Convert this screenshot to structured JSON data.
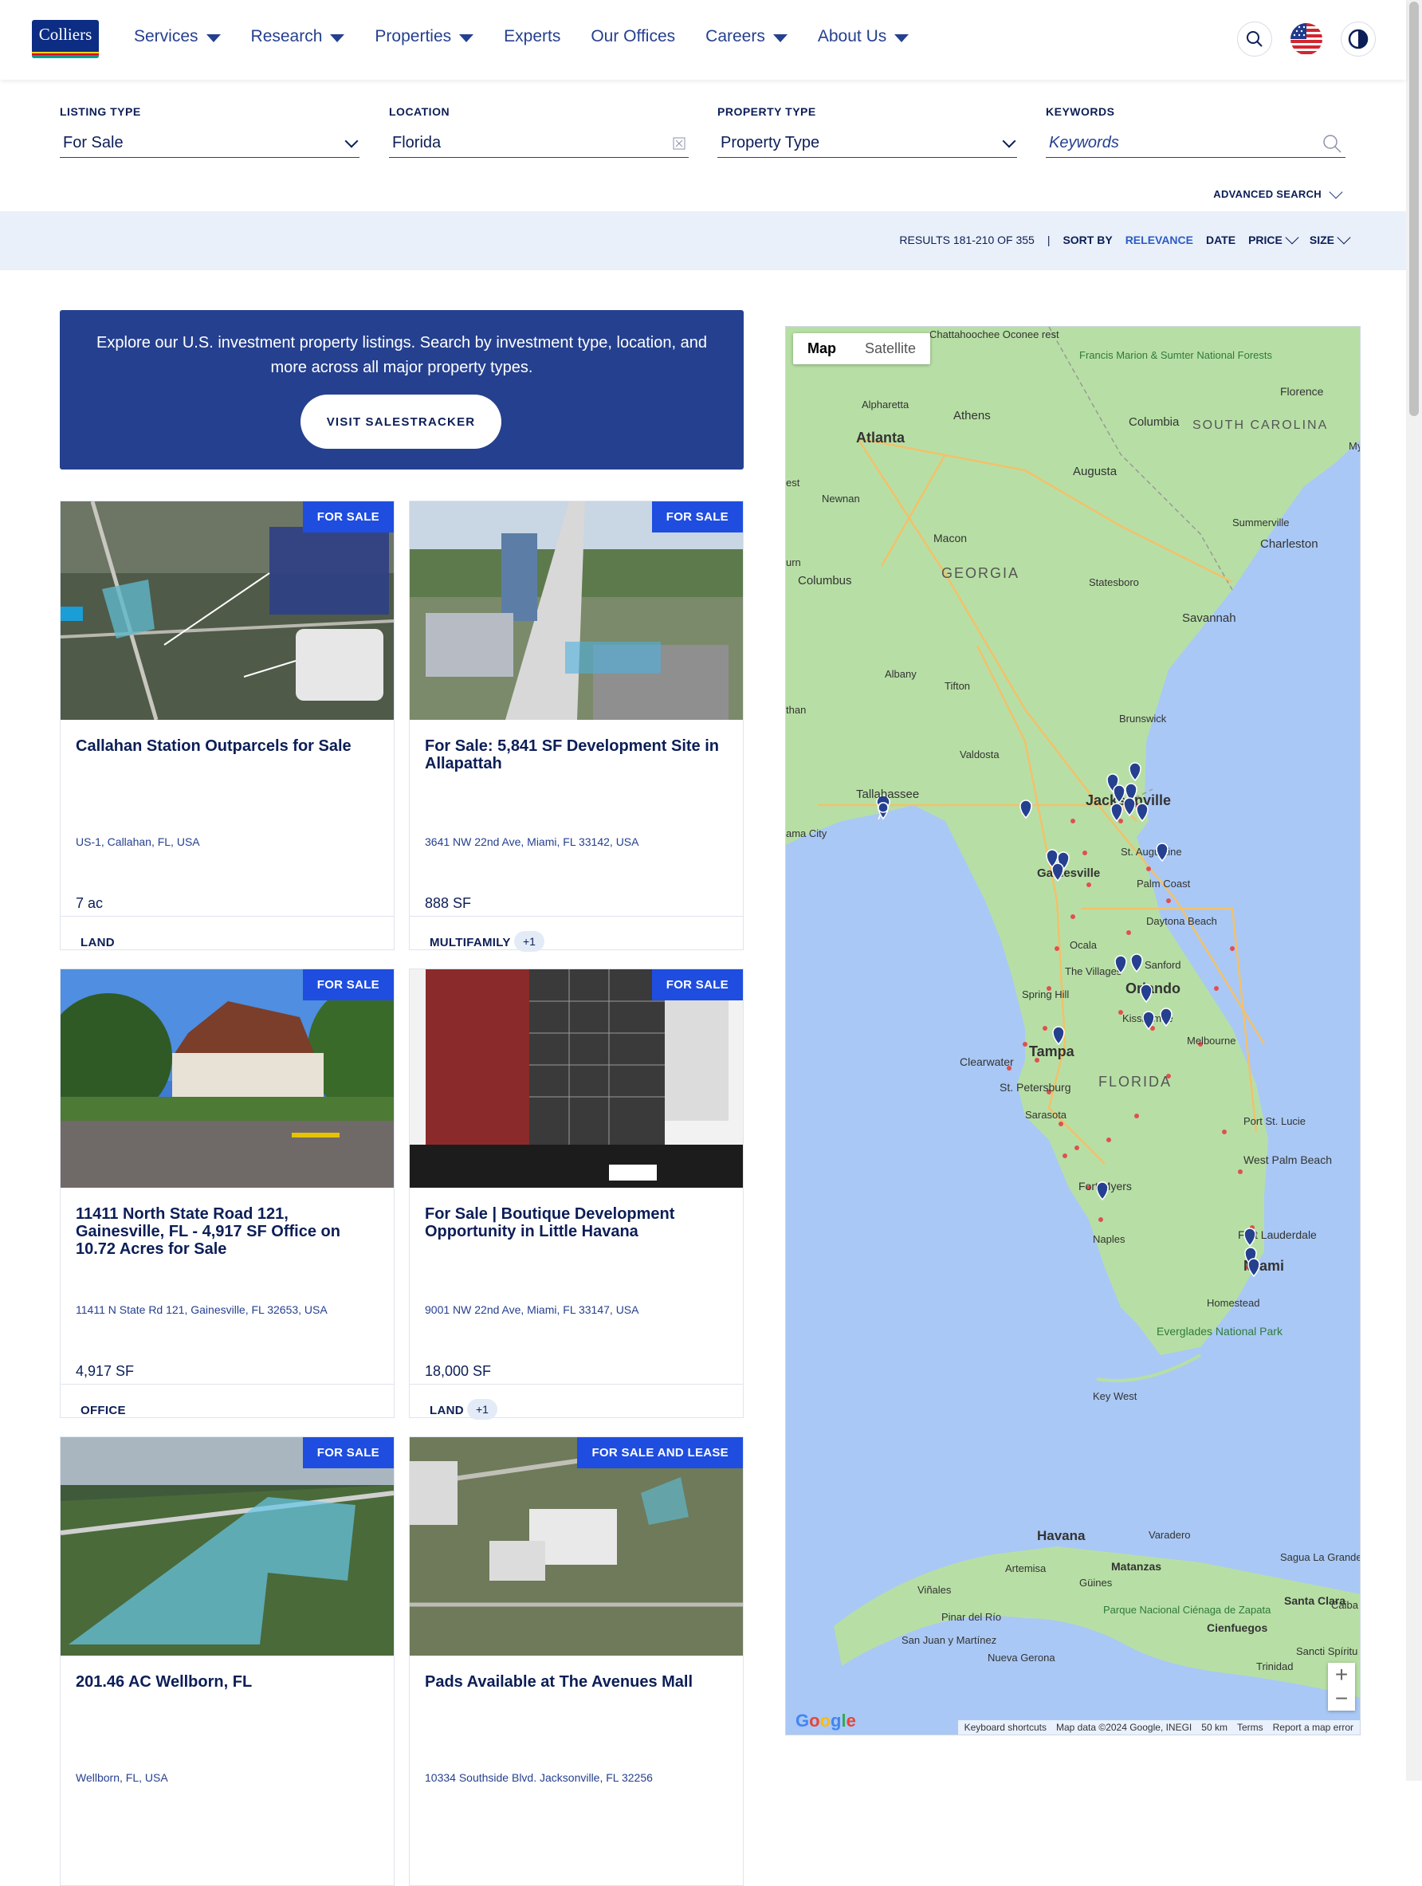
{
  "brand": {
    "logo_text": "Colliers",
    "logo_stripes": [
      "#ffd400",
      "#e4002b",
      "#00a651",
      "#0096d6"
    ]
  },
  "nav": {
    "items": [
      {
        "label": "Services",
        "has_dropdown": true
      },
      {
        "label": "Research",
        "has_dropdown": true
      },
      {
        "label": "Properties",
        "has_dropdown": true
      },
      {
        "label": "Experts",
        "has_dropdown": false
      },
      {
        "label": "Our Offices",
        "has_dropdown": false
      },
      {
        "label": "Careers",
        "has_dropdown": true
      },
      {
        "label": "About Us",
        "has_dropdown": true
      }
    ],
    "icons": [
      "search-icon",
      "us-flag-icon",
      "contrast-icon"
    ]
  },
  "filters": {
    "listing_type": {
      "label": "LISTING TYPE",
      "value": "For Sale"
    },
    "location": {
      "label": "LOCATION",
      "value": "Florida"
    },
    "property_type": {
      "label": "PROPERTY TYPE",
      "value": "Property Type"
    },
    "keywords": {
      "label": "KEYWORDS",
      "placeholder": "Keywords"
    },
    "advanced": "ADVANCED SEARCH"
  },
  "results": {
    "count_text": "RESULTS 181-210 OF 355",
    "separator": "|",
    "sort_by": "SORT BY",
    "sort_options": [
      "RELEVANCE",
      "DATE",
      "PRICE",
      "SIZE"
    ],
    "active_sort": "RELEVANCE"
  },
  "promo": {
    "text": "Explore our U.S. investment property listings. Search by investment type, location, and more across all major property types.",
    "button": "VISIT SALESTRACKER"
  },
  "listings": [
    {
      "badge": "FOR SALE",
      "title": "Callahan Station Outparcels for Sale",
      "address": "US-1, Callahan, FL, USA",
      "size": "7 ac",
      "type": "LAND",
      "extra": ""
    },
    {
      "badge": "FOR SALE",
      "title": "For Sale: 5,841 SF Development Site in Allapattah",
      "address": "3641 NW 22nd Ave, Miami, FL 33142, USA",
      "size": "888 SF",
      "type": "MULTIFAMILY",
      "extra": "+1"
    },
    {
      "badge": "FOR SALE",
      "title": "11411 North State Road 121, Gainesville, FL - 4,917 SF Office on 10.72 Acres for Sale",
      "address": "11411 N State Rd 121, Gainesville, FL 32653, USA",
      "size": "4,917 SF",
      "type": "OFFICE",
      "extra": ""
    },
    {
      "badge": "FOR SALE",
      "title": "For Sale | Boutique Development Opportunity in Little Havana",
      "address": "9001 NW 22nd Ave, Miami, FL 33147, USA",
      "size": "18,000 SF",
      "type": "LAND",
      "extra": "+1"
    },
    {
      "badge": "FOR SALE",
      "title": "201.46 AC Wellborn, FL",
      "address": "Wellborn, FL, USA",
      "size": "",
      "type": "",
      "extra": ""
    },
    {
      "badge": "FOR SALE AND LEASE",
      "title": "Pads Available at The Avenues Mall",
      "address": "10334 Southside Blvd. Jacksonville, FL 32256",
      "size": "",
      "type": "",
      "extra": ""
    }
  ],
  "map": {
    "tabs": [
      "Map",
      "Satellite"
    ],
    "active_tab": "Map",
    "zoom_in": "+",
    "zoom_out": "−",
    "labels": {
      "atlanta": "Atlanta",
      "athens": "Athens",
      "alpharetta": "Alpharetta",
      "augusta": "Augusta",
      "columbia": "Columbia",
      "florence": "Florence",
      "south_carolina": "SOUTH CAROLINA",
      "francis": "Francis Marion & Sumter National Forests",
      "newnan": "Newnan",
      "macon": "Macon",
      "georgia": "GEORGIA",
      "columbus": "Columbus",
      "statesboro": "Statesboro",
      "summerville": "Summerville",
      "charleston": "Charleston",
      "savannah": "Savannah",
      "albany": "Albany",
      "tifton": "Tifton",
      "brunswick": "Brunswick",
      "valdosta": "Valdosta",
      "tallahassee": "Tallahassee",
      "panama_city": "ama City",
      "jacksonville": "Jacksonville",
      "st_augustine": "St. Augustine",
      "gainesville": "Gainesville",
      "palm_coast": "Palm Coast",
      "daytona": "Daytona Beach",
      "ocala": "Ocala",
      "the_villages": "The Villages",
      "sanford": "Sanford",
      "orlando": "Orlando",
      "spring_hill": "Spring Hill",
      "kissimmee": "Kissimmee",
      "tampa": "Tampa",
      "melbourne": "Melbourne",
      "clearwater": "Clearwater",
      "st_pete": "St. Petersburg",
      "florida": "FLORIDA",
      "sarasota": "Sarasota",
      "port_st_lucie": "Port St. Lucie",
      "west_palm": "West Palm Beach",
      "fort_myers": "Fort Myers",
      "naples": "Naples",
      "fort_lauderdale": "Fort Lauderdale",
      "miami": "Miami",
      "homestead": "Homestead",
      "everglades": "Everglades National Park",
      "key_west": "Key West",
      "havana": "Havana",
      "varadero": "Varadero",
      "matanzas": "Matanzas",
      "artemisa": "Artemisa",
      "guines": "Güines",
      "vinales": "Viñales",
      "pinar": "Pinar del Río",
      "sagua": "Sagua La Grande",
      "santa_clara": "Santa Clara",
      "cienfuegos": "Cienfuegos",
      "parque": "Parque Nacional Ciénaga de Zapata",
      "nueva_gerona": "Nueva Gerona",
      "san_juan": "San Juan y Martínez",
      "trinidad": "Trinidad",
      "sancti": "Sancti Spíritu",
      "caiba": "Caiba",
      "my": "My",
      "est": "est",
      "urn": "urn",
      "than": "than",
      "chattahoochee": "Chattahoochee Oconee rest"
    },
    "footer": [
      "Keyboard shortcuts",
      "Map data ©2024 Google, INEGI",
      "50 km",
      "Terms",
      "Report a map error"
    ],
    "google": "Google",
    "colors": {
      "land": "#b7dfa5",
      "water": "#a9c8f5",
      "pin": "#25408f",
      "route": "#e05050"
    }
  }
}
